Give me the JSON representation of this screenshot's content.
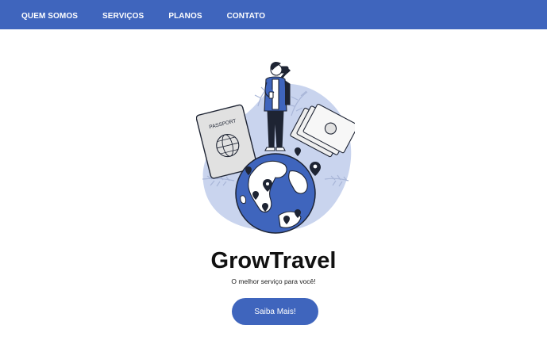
{
  "nav": {
    "items": [
      {
        "label": "QUEM SOMOS"
      },
      {
        "label": "SERVIÇOS"
      },
      {
        "label": "PLANOS"
      },
      {
        "label": "CONTATO"
      }
    ]
  },
  "hero": {
    "illustration_icon": "traveler-on-globe-icon",
    "passport_text": "PASSPORT",
    "title": "GrowTravel",
    "subtitle": "O melhor serviço para você!",
    "cta_label": "Saiba Mais!"
  },
  "colors": {
    "primary": "#3f65bd",
    "primary_light": "#c9d4ee",
    "dark": "#1e2433"
  }
}
